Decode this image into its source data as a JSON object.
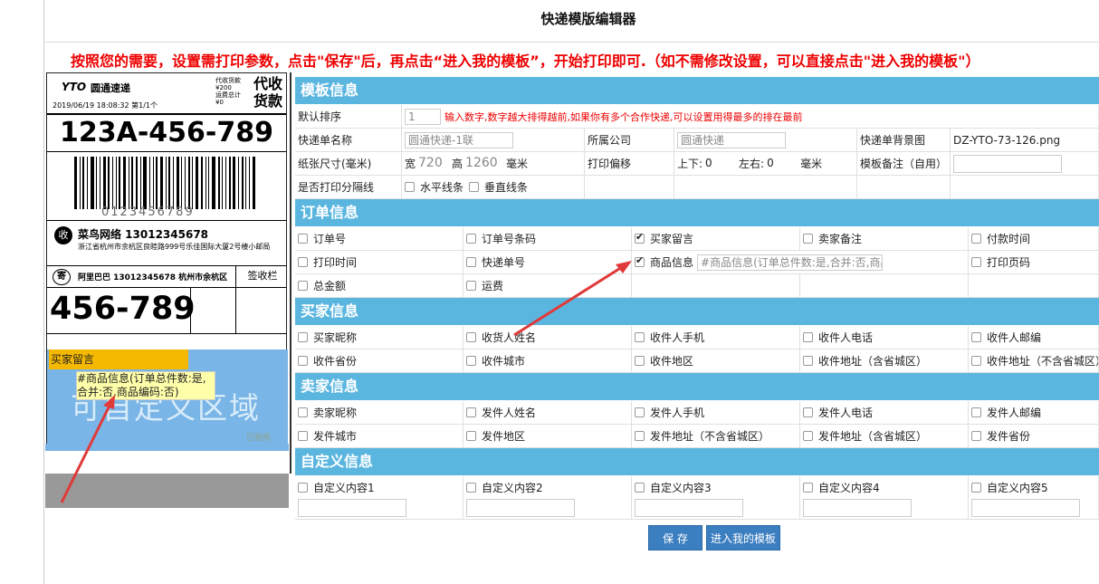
{
  "page": {
    "title": "快递模版编辑器",
    "instruction": "按照您的需要，设置需打印参数，点击\"保存\"后，再点击“进入我的模板”，开始打印即可.（如不需修改设置，可以直接点击\"进入我的模板\"）"
  },
  "preview": {
    "logo_mark": "YTO",
    "logo_name": "圆通速递",
    "date": "2019/06/19   18:08:32   第1/1个",
    "fees": [
      "代收货款",
      "¥200",
      "运费总计",
      "¥0"
    ],
    "cod": "代收货款",
    "tracking": "123A-456-789",
    "barcode_number": "0123456789",
    "cainiao_title": "菜鸟网络   13012345678",
    "cainiao_addr": "浙江省杭州市余杭区良睦路999号乐佳国际大厦2号楼小邮局",
    "sender_icon": "寄",
    "sender": "阿里巴巴 13012345678  杭州市余杭区",
    "sign": "签收栏",
    "route": "456-789",
    "custom_area": "可自定义区域",
    "buyer_note_tag": "买家留言",
    "goods_tag": "#商品信息(订单总件数:是,合并:否,商品编码:否)",
    "verified": "已验视"
  },
  "template": {
    "section": "模板信息",
    "sort_label": "默认排序",
    "sort_value": "1",
    "sort_hint": "输入数字,数字越大排得越前,如果你有多个合作快递,可以设置用得最多的排在最前",
    "name_label": "快递单名称",
    "name_value": "圆通快递-1联",
    "company_label": "所属公司",
    "company_value": "圆通快递",
    "bg_label": "快递单背景图",
    "bg_value": "DZ-YTO-73-126.png",
    "paper_label": "纸张尺寸(毫米)",
    "width_label": "宽",
    "width_value": "720",
    "height_label": "高",
    "height_value": "1260",
    "mm": "毫米",
    "offset_label": "打印偏移",
    "ud_label": "上下:",
    "ud_value": "0",
    "lr_label": "左右:",
    "lr_value": "0",
    "note_label": "模板备注（自用）",
    "note_value": "",
    "sep_label": "是否打印分隔线",
    "h_line": "水平线条",
    "v_line": "垂直线条"
  },
  "order": {
    "section": "订单信息",
    "row1": [
      {
        "label": "订单号",
        "checked": false
      },
      {
        "label": "订单号条码",
        "checked": false
      },
      {
        "label": "买家留言",
        "checked": true
      },
      {
        "label": "卖家备注",
        "checked": false
      },
      {
        "label": "付款时间",
        "checked": false
      }
    ],
    "row2": [
      {
        "label": "打印时间",
        "checked": false
      },
      {
        "label": "快递单号",
        "checked": false
      },
      {
        "label": "商品信息",
        "checked": true
      },
      {
        "label": "打印页码",
        "checked": false
      }
    ],
    "goods_value": "#商品信息(订单总件数:是,合并:否,商品编码:否)",
    "row3": [
      {
        "label": "总金额",
        "checked": false
      },
      {
        "label": "运费",
        "checked": false
      }
    ]
  },
  "buyer": {
    "section": "买家信息",
    "row1": [
      {
        "label": "买家昵称",
        "checked": false
      },
      {
        "label": "收货人姓名",
        "checked": false
      },
      {
        "label": "收件人手机",
        "checked": false
      },
      {
        "label": "收件人电话",
        "checked": false
      },
      {
        "label": "收件人邮编",
        "checked": false
      }
    ],
    "row2": [
      {
        "label": "收件省份",
        "checked": false
      },
      {
        "label": "收件城市",
        "checked": false
      },
      {
        "label": "收件地区",
        "checked": false
      },
      {
        "label": "收件地址（含省城区）",
        "checked": false
      },
      {
        "label": "收件地址（不含省城区）",
        "checked": false
      }
    ]
  },
  "seller": {
    "section": "卖家信息",
    "row1": [
      {
        "label": "卖家昵称",
        "checked": false
      },
      {
        "label": "发件人姓名",
        "checked": false
      },
      {
        "label": "发件人手机",
        "checked": false
      },
      {
        "label": "发件人电话",
        "checked": false
      },
      {
        "label": "发件人邮编",
        "checked": false
      }
    ],
    "row2": [
      {
        "label": "发件城市",
        "checked": false
      },
      {
        "label": "发件地区",
        "checked": false
      },
      {
        "label": "发件地址（不含省城区）",
        "checked": false
      },
      {
        "label": "发件地址（含省城区）",
        "checked": false
      },
      {
        "label": "发件省份",
        "checked": false
      }
    ]
  },
  "custom": {
    "section": "自定义信息",
    "items": [
      {
        "label": "自定义内容1",
        "checked": false,
        "value": ""
      },
      {
        "label": "自定义内容2",
        "checked": false,
        "value": ""
      },
      {
        "label": "自定义内容3",
        "checked": false,
        "value": ""
      },
      {
        "label": "自定义内容4",
        "checked": false,
        "value": ""
      },
      {
        "label": "自定义内容5",
        "checked": false,
        "value": ""
      }
    ]
  },
  "buttons": {
    "save": "保    存",
    "enter": "进入我的模板"
  },
  "colors": {
    "section_bg": "#5bb6df",
    "instruction": "#e00000",
    "button": "#3c7fc0",
    "arrow": "#e03a3a"
  }
}
